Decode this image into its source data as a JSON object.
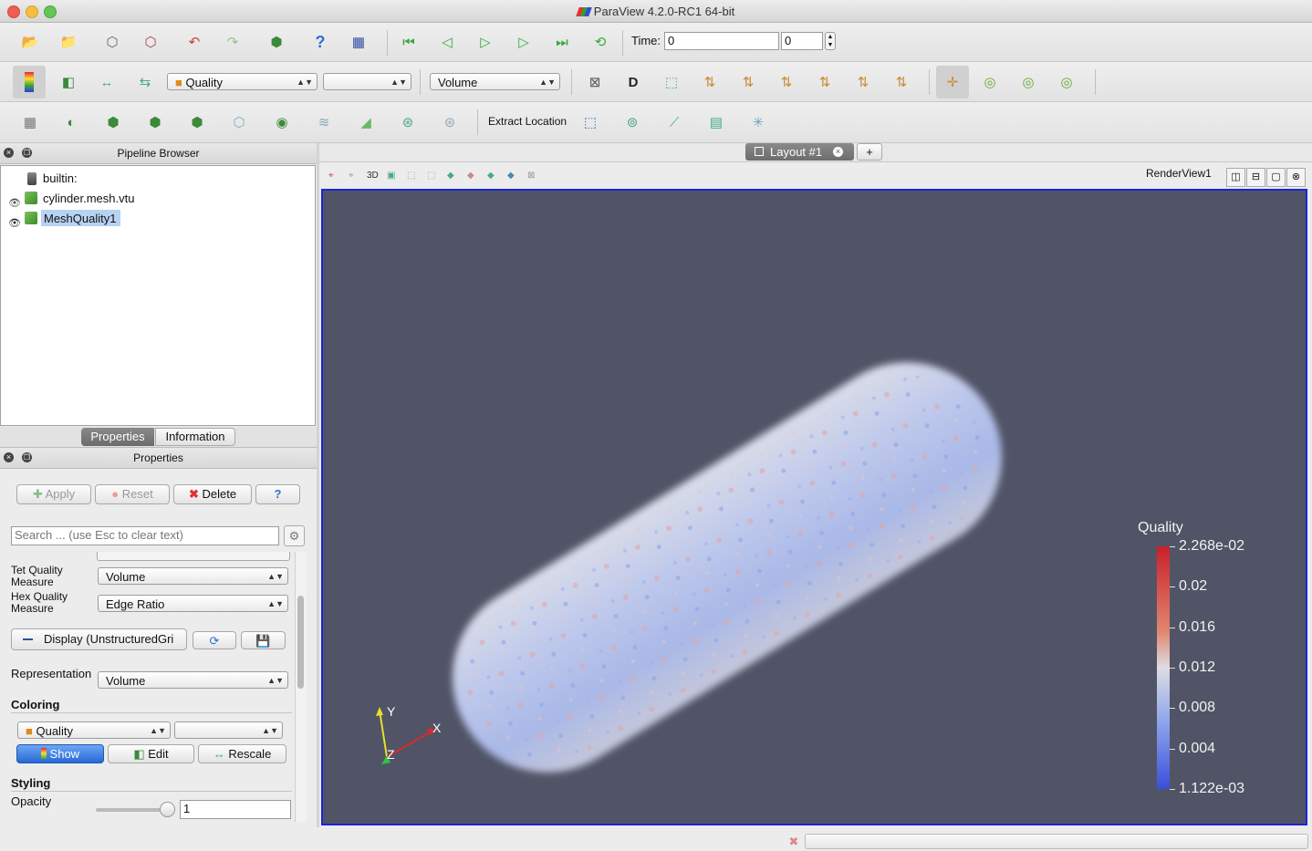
{
  "window": {
    "title": "ParaView 4.2.0-RC1 64-bit"
  },
  "toolbar_main": {
    "time_label": "Time:",
    "time_value": "0",
    "timestep_value": "0"
  },
  "toolbar_vis": {
    "color_array": "Quality",
    "component": "",
    "representation": "Volume"
  },
  "toolbar_filters": {
    "extract_location_label": "Extract Location"
  },
  "pipeline": {
    "title": "Pipeline Browser",
    "items": [
      {
        "label": "builtin:"
      },
      {
        "label": "cylinder.mesh.vtu"
      },
      {
        "label": "MeshQuality1"
      }
    ]
  },
  "tabs": {
    "properties": "Properties",
    "information": "Information"
  },
  "properties": {
    "title": "Properties",
    "apply": "Apply",
    "reset": "Reset",
    "delete": "Delete",
    "help": "?",
    "search_placeholder": "Search ... (use Esc to clear text)",
    "tet_label": "Tet Quality Measure",
    "tet_value": "Volume",
    "hex_label": "Hex Quality Measure",
    "hex_value": "Edge Ratio",
    "display_label": "Display (UnstructuredGri",
    "representation_label": "Representation",
    "representation_value": "Volume",
    "coloring_header": "Coloring",
    "coloring_array": "Quality",
    "coloring_component": "",
    "show": "Show",
    "edit": "Edit",
    "rescale": "Rescale",
    "styling_header": "Styling",
    "opacity_label": "Opacity",
    "opacity_value": "1",
    "opacity_level": 1.0
  },
  "layout": {
    "tab_label": "Layout #1",
    "add_tab": "+",
    "view_name": "RenderView1",
    "toolbar_3d": "3D"
  },
  "colorbar": {
    "title": "Quality",
    "labels": [
      "2.268e-02",
      "0.02",
      "0.016",
      "0.012",
      "0.008",
      "0.004",
      "1.122e-03"
    ]
  },
  "axes": {
    "x": "X",
    "y": "Y",
    "z": "Z"
  },
  "colors": {
    "render_bg": "#515466",
    "active_border": "#1a25d8",
    "selection": "#b7d2f3"
  }
}
